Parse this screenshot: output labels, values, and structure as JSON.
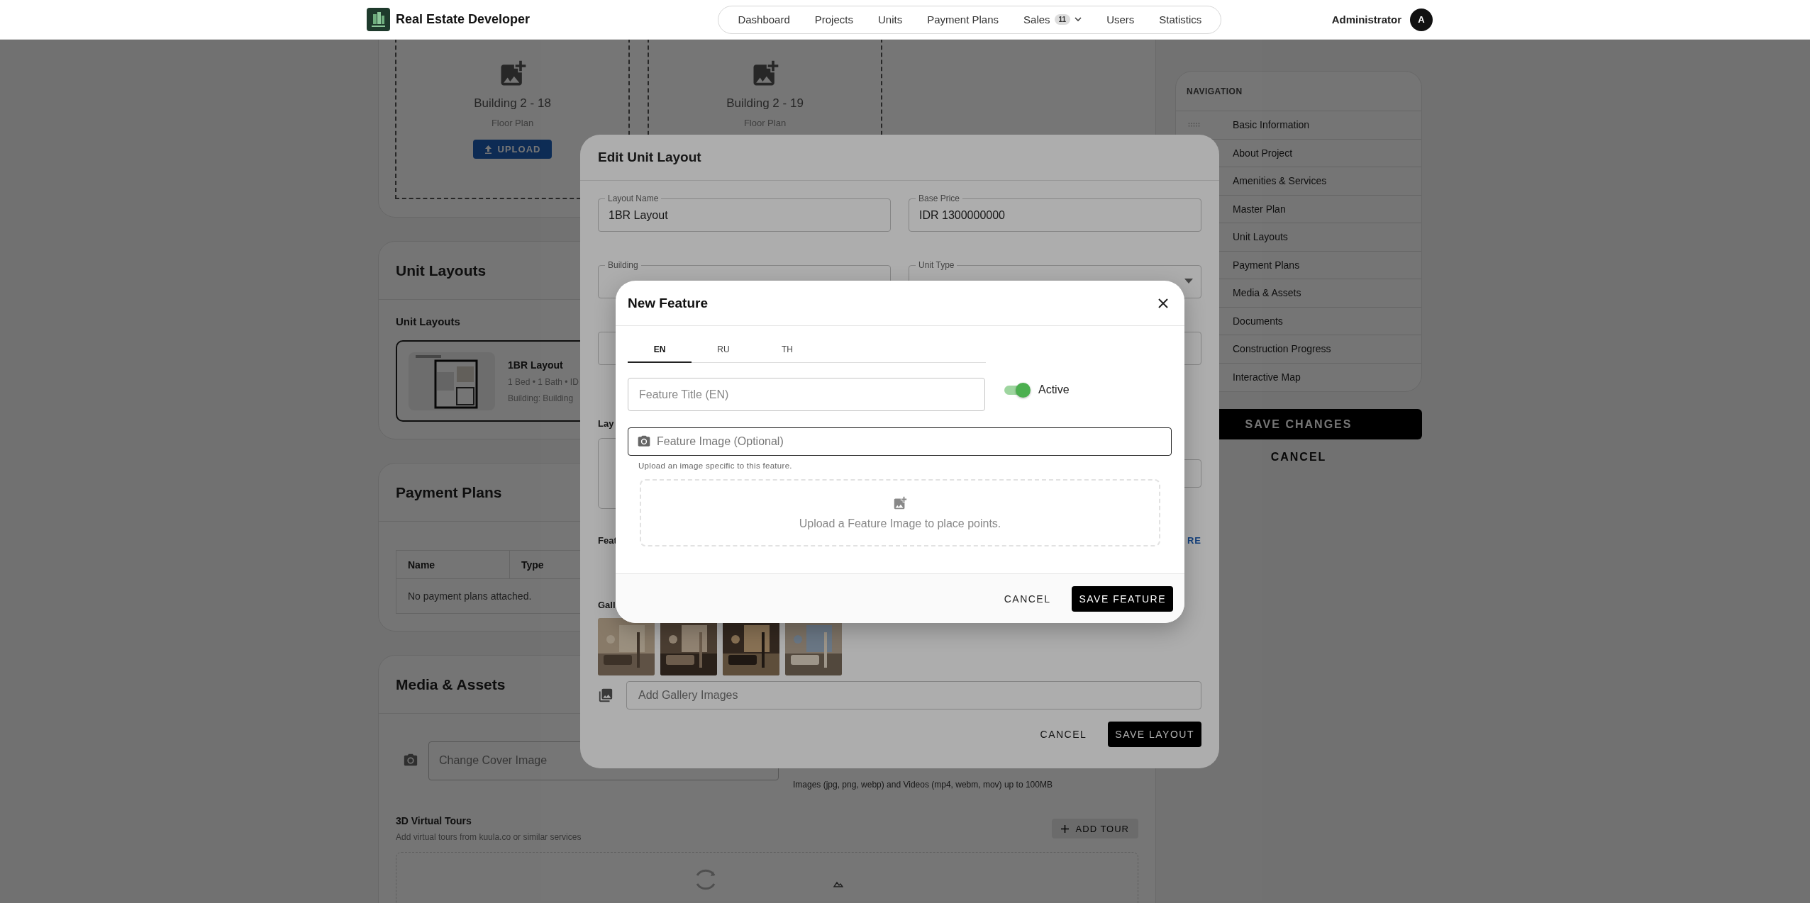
{
  "header": {
    "brand": "Real Estate Developer",
    "nav": [
      {
        "label": "Dashboard"
      },
      {
        "label": "Projects"
      },
      {
        "label": "Units"
      },
      {
        "label": "Payment Plans"
      },
      {
        "label": "Sales",
        "badge": "11",
        "dropdown": true
      },
      {
        "label": "Users"
      },
      {
        "label": "Statistics"
      }
    ],
    "user": {
      "name": "Administrator",
      "initial": "A"
    }
  },
  "floor_plans": [
    {
      "title": "Building 2 - 18",
      "subtitle": "Floor Plan",
      "button": "UPLOAD"
    },
    {
      "title": "Building 2 - 19",
      "subtitle": "Floor Plan"
    }
  ],
  "unit_layouts": {
    "title": "Unit Layouts",
    "subtitle": "Unit Layouts",
    "items": [
      {
        "name": "1BR Layout",
        "details": "1 Bed • 1 Bath • ID",
        "building": "Building: Building"
      }
    ]
  },
  "payment_plans": {
    "title": "Payment Plans",
    "columns": [
      "Name",
      "Type"
    ],
    "empty": "No payment plans attached."
  },
  "media": {
    "title": "Media & Assets",
    "cover_placeholder": "Change Cover Image",
    "hint": "Images (jpg, png, webp) and Videos (mp4, webm, mov) up to 100MB",
    "tours_title": "3D Virtual Tours",
    "tours_subtitle": "Add virtual tours from kuula.co or similar services",
    "add_tour": "ADD TOUR"
  },
  "sidebar": {
    "title": "NAVIGATION",
    "items": [
      {
        "label": "Basic Information",
        "handle": true
      },
      {
        "label": "About Project",
        "handle": false
      },
      {
        "label": "Amenities & Services",
        "handle": false
      },
      {
        "label": "Master Plan",
        "handle": false
      },
      {
        "label": "Unit Layouts",
        "handle": false
      },
      {
        "label": "Payment Plans",
        "handle": false
      },
      {
        "label": "Media & Assets",
        "handle": false
      },
      {
        "label": "Documents",
        "handle": false
      },
      {
        "label": "Construction Progress",
        "handle": false
      },
      {
        "label": "Interactive Map",
        "handle": false
      }
    ],
    "save": "SAVE CHANGES",
    "cancel": "CANCEL"
  },
  "edit_dialog": {
    "title": "Edit Unit Layout",
    "fields": [
      {
        "label": "Layout Name",
        "value": "1BR Layout"
      },
      {
        "label": "Base Price",
        "value": "IDR 1300000000"
      },
      {
        "label": "Building"
      },
      {
        "label": "Unit Type",
        "kind": "select"
      }
    ],
    "layout_label": "Lay",
    "features_label": "Feat",
    "features_link": "RE",
    "gallery_label": "Gall",
    "gallery_placeholder": "Add Gallery Images",
    "cancel": "CANCEL",
    "save": "SAVE LAYOUT"
  },
  "new_feature": {
    "title": "New Feature",
    "tabs": [
      {
        "label": "EN",
        "selected": true
      },
      {
        "label": "RU",
        "selected": false
      },
      {
        "label": "TH",
        "selected": false
      }
    ],
    "title_placeholder": "Feature Title (EN)",
    "active": {
      "label": "Active",
      "on": true
    },
    "image_placeholder": "Feature Image (Optional)",
    "image_help": "Upload an image specific to this feature.",
    "dropzone": "Upload a Feature Image to place points.",
    "cancel": "CANCEL",
    "save": "SAVE FEATURE"
  }
}
